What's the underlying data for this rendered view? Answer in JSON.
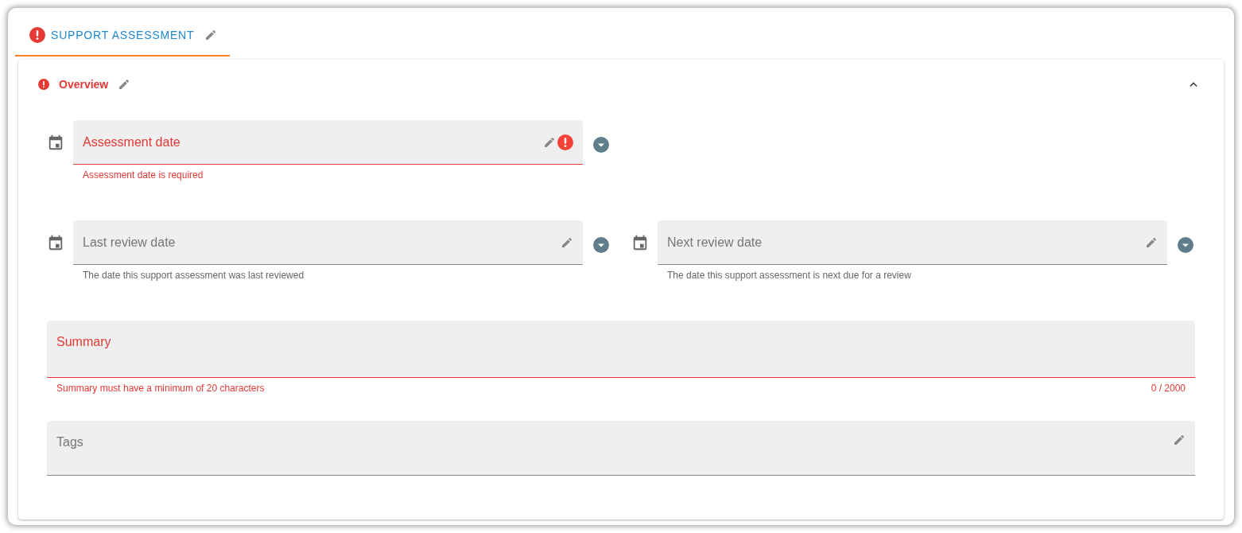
{
  "tab": {
    "label": "SUPPORT ASSESSMENT",
    "selected": true,
    "error": true
  },
  "section": {
    "title": "Overview",
    "error": true,
    "expanded": true
  },
  "date_rows": [
    [
      {
        "label": "Assessment date",
        "error": true,
        "message": "Assessment date is required"
      }
    ],
    [
      {
        "label": "Last review date",
        "error": false,
        "message": "The date this support assessment was last reviewed"
      },
      {
        "label": "Next review date",
        "error": false,
        "message": "The date this support assessment is next due for a review"
      }
    ]
  ],
  "summary": {
    "label": "Summary",
    "error": true,
    "message": "Summary must have a minimum of 20 characters",
    "counter": "0 / 2000"
  },
  "tags": {
    "label": "Tags",
    "error": false
  }
}
